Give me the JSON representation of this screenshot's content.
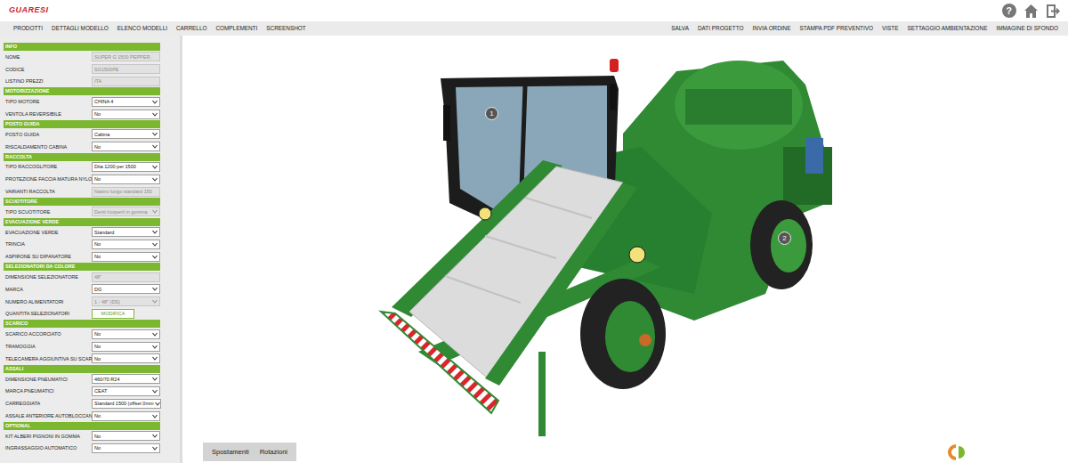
{
  "header": {
    "logo": "GUARESI",
    "help": "?"
  },
  "menu": {
    "left": [
      "PRODOTTI",
      "DETTAGLI MODELLO",
      "ELENCO MODELLI",
      "CARRELLO",
      "COMPLEMENTI",
      "SCREENSHOT"
    ],
    "right": [
      "SALVA",
      "DATI PROGETTO",
      "INVIA ORDINE",
      "STAMPA PDF PREVENTIVO",
      "VISTE",
      "SETTAGGIO AMBIENTAZIONE",
      "IMMAGINE DI SFONDO"
    ]
  },
  "sidebar": {
    "sections": [
      {
        "title": "INFO",
        "rows": [
          {
            "label": "NOME",
            "kind": "text",
            "value": "SUPER G 1500 PEPPER.",
            "disabled": true
          },
          {
            "label": "CODICE",
            "kind": "text",
            "value": "SG1500PE",
            "disabled": true
          },
          {
            "label": "LISTINO PREZZI",
            "kind": "text",
            "value": "ITA",
            "disabled": true
          }
        ]
      },
      {
        "title": "MOTORIZZAZIONE",
        "rows": [
          {
            "label": "TIPO MOTORE",
            "kind": "select",
            "value": "CHINA 4",
            "disabled": false
          },
          {
            "label": "VENTOLA REVERSIBILE",
            "kind": "select",
            "value": "No",
            "disabled": false
          }
        ]
      },
      {
        "title": "POSTO GUIDA",
        "rows": [
          {
            "label": "POSTO GUIDA",
            "kind": "select",
            "value": "Cabina",
            "disabled": false
          },
          {
            "label": "RISCALDAMENTO CABINA",
            "kind": "select",
            "value": "No",
            "disabled": false
          }
        ]
      },
      {
        "title": "RACCOLTA",
        "rows": [
          {
            "label": "TIPO RACCOGLITORE",
            "kind": "select",
            "value": "Dita 1200 per 1500",
            "disabled": false
          },
          {
            "label": "PROTEZIONE FACCIA MATURA NYLON",
            "kind": "select",
            "value": "No",
            "disabled": false
          },
          {
            "label": "VARIANTI RACCOLTA",
            "kind": "text",
            "value": "Nastro lungo standard 150",
            "disabled": true
          }
        ]
      },
      {
        "title": "SCUOTITORE",
        "rows": [
          {
            "label": "TIPO SCUOTITORE",
            "kind": "select",
            "value": "Denti ricoperti in gomma",
            "disabled": true
          }
        ]
      },
      {
        "title": "EVACUAZIONE VERDE",
        "rows": [
          {
            "label": "EVACUAZIONE VERDE",
            "kind": "select",
            "value": "Standard",
            "disabled": false
          },
          {
            "label": "TRINCIA",
            "kind": "select",
            "value": "No",
            "disabled": false
          },
          {
            "label": "ASPIRONE SU DIPANATORE",
            "kind": "select",
            "value": "No",
            "disabled": false
          }
        ]
      },
      {
        "title": "SELEZIONATORI DA COLORE",
        "rows": [
          {
            "label": "DIMENSIONE SELEZIONATORE",
            "kind": "text",
            "value": "48\"",
            "disabled": true
          },
          {
            "label": "MARCA",
            "kind": "select",
            "value": "DG",
            "disabled": false
          },
          {
            "label": "NUMERO ALIMENTATORI",
            "kind": "select",
            "value": "1 - 48\" (DS)",
            "disabled": true
          },
          {
            "label": "QUANTITA SELEZIONATORI",
            "kind": "button",
            "value": "MODIFICA",
            "disabled": false
          }
        ]
      },
      {
        "title": "SCARICO",
        "rows": [
          {
            "label": "SCARICO ACCORCIATO",
            "kind": "select",
            "value": "No",
            "disabled": false
          },
          {
            "label": "TRAMOGGIA",
            "kind": "select",
            "value": "No",
            "disabled": false
          },
          {
            "label": "TELECAMERA AGGIUNTIVA SU SCARICO",
            "kind": "select",
            "value": "No",
            "disabled": false
          }
        ]
      },
      {
        "title": "ASSALI",
        "rows": [
          {
            "label": "DIMENSIONE PNEUMATICI",
            "kind": "select",
            "value": "460/70 R24",
            "disabled": false
          },
          {
            "label": "MARCA PNEUMATICI",
            "kind": "select",
            "value": "CEAT",
            "disabled": false
          },
          {
            "label": "CARREGGIATA",
            "kind": "select",
            "value": "Standard 1500 (offset 0mm",
            "disabled": false
          },
          {
            "label": "ASSALE ANTERIORE AUTOBLOCCANTE",
            "kind": "select",
            "value": "No",
            "disabled": false
          }
        ]
      },
      {
        "title": "OPTIONAL",
        "rows": [
          {
            "label": "KIT ALBERI PIGNONI IN GOMMA",
            "kind": "select",
            "value": "No",
            "disabled": false
          },
          {
            "label": "INGRASSAGGIO AUTOMATICO",
            "kind": "select",
            "value": "No",
            "disabled": false
          }
        ]
      }
    ]
  },
  "viewer": {
    "hotspots": [
      "1",
      "2"
    ],
    "controls": [
      "Spostamenti",
      "Rotazioni"
    ]
  }
}
